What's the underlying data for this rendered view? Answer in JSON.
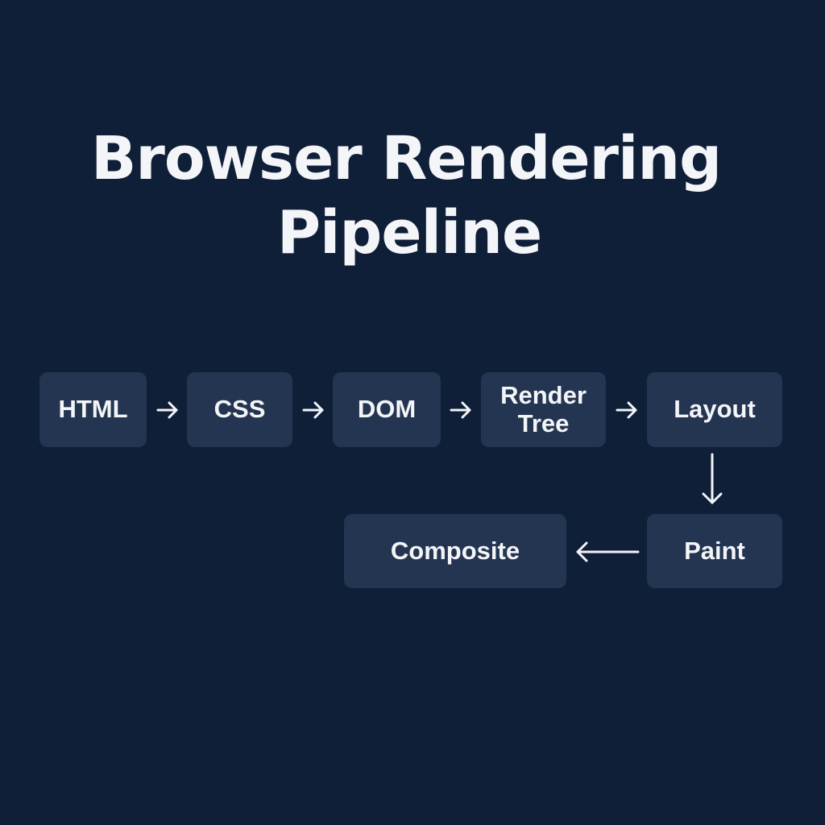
{
  "title": {
    "line1": "Browser Rendering",
    "line2": "Pipeline"
  },
  "nodes": {
    "html": "HTML",
    "css": "CSS",
    "dom": "DOM",
    "render_tree": "Render Tree",
    "layout": "Layout",
    "paint": "Paint",
    "composite": "Composite"
  },
  "edges": [
    [
      "HTML",
      "CSS"
    ],
    [
      "CSS",
      "DOM"
    ],
    [
      "DOM",
      "Render Tree"
    ],
    [
      "Render Tree",
      "Layout"
    ],
    [
      "Layout",
      "Paint"
    ],
    [
      "Paint",
      "Composite"
    ]
  ],
  "colors": {
    "background": "#0f1f38",
    "node_fill": "#243551",
    "text": "#f4f5f8"
  }
}
